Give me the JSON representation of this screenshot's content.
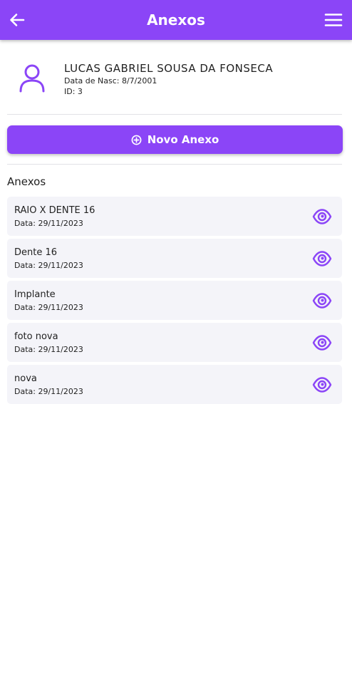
{
  "appbar": {
    "title": "Anexos",
    "back_icon": "arrow-left-icon",
    "menu_icon": "hamburger-menu-icon",
    "color": "#8b45f7"
  },
  "patient": {
    "name": "LUCAS GABRIEL SOUSA DA FONSECA",
    "dob": "Data de Nasc: 8/7/2001",
    "id": "ID: 3",
    "avatar_icon": "user-outline-icon"
  },
  "new_button": {
    "label": "Novo Anexo",
    "icon": "plus-circle-icon"
  },
  "section": {
    "title": "Anexos"
  },
  "attachments": [
    {
      "name": "RAIO X DENTE 16",
      "date": "Data: 29/11/2023",
      "action_icon": "eye-icon"
    },
    {
      "name": "Dente 16",
      "date": "Data: 29/11/2023",
      "action_icon": "eye-icon"
    },
    {
      "name": "Implante",
      "date": "Data: 29/11/2023",
      "action_icon": "eye-icon"
    },
    {
      "name": "foto nova",
      "date": "Data: 29/11/2023",
      "action_icon": "eye-icon"
    },
    {
      "name": "nova",
      "date": "Data: 29/11/2023",
      "action_icon": "eye-icon"
    }
  ]
}
